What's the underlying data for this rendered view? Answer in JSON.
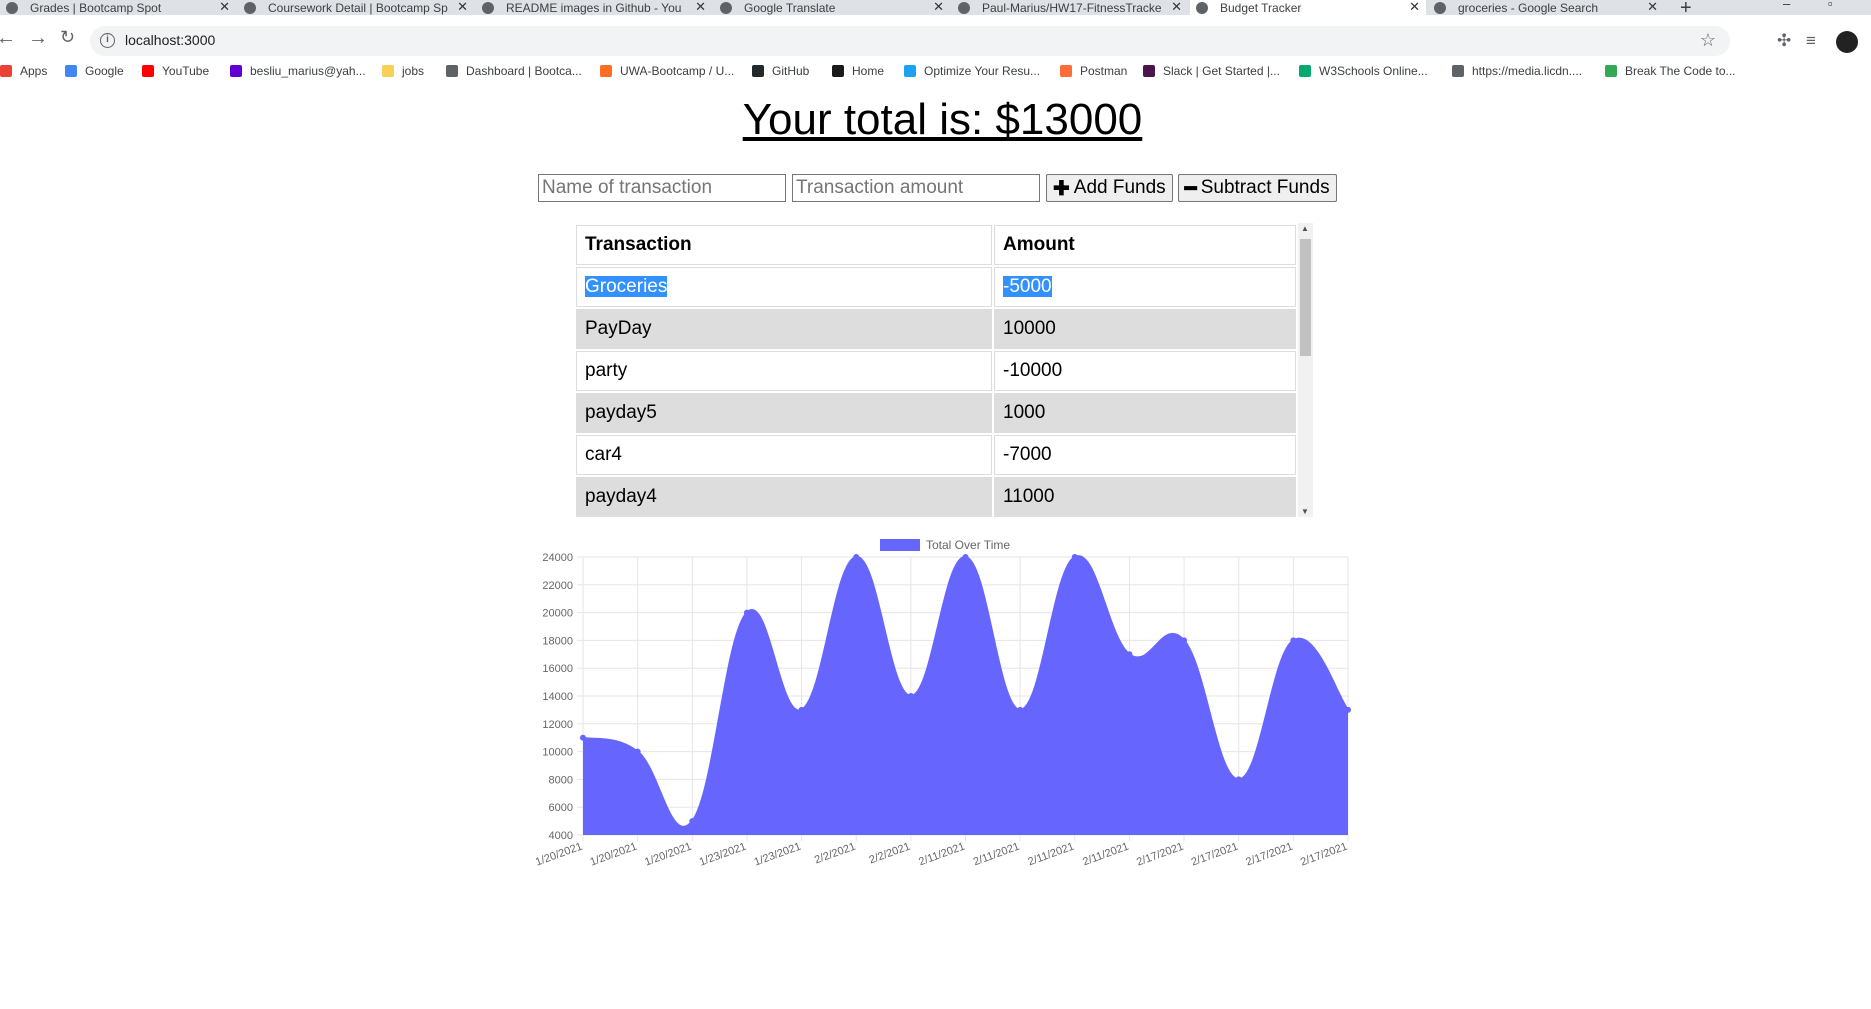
{
  "browser": {
    "tabs": [
      {
        "title": "Grades | Bootcamp Spot",
        "active": false
      },
      {
        "title": "Coursework Detail | Bootcamp Sp",
        "active": false
      },
      {
        "title": "README images in Github - You",
        "active": false
      },
      {
        "title": "Google Translate",
        "active": false
      },
      {
        "title": "Paul-Marius/HW17-FitnessTracke",
        "active": false
      },
      {
        "title": "Budget Tracker",
        "active": true
      },
      {
        "title": "groceries - Google Search",
        "active": false
      }
    ],
    "url": "localhost:3000",
    "bookmarks": [
      {
        "label": "Apps",
        "color": "#ea4335"
      },
      {
        "label": "Google",
        "color": "#4285f4"
      },
      {
        "label": "YouTube",
        "color": "#ff0000"
      },
      {
        "label": "besliu_marius@yah...",
        "color": "#6001d2"
      },
      {
        "label": "jobs",
        "color": "#f6d155"
      },
      {
        "label": "Dashboard | Bootca...",
        "color": "#5f6368"
      },
      {
        "label": "UWA-Bootcamp / U...",
        "color": "#fc6d26"
      },
      {
        "label": "GitHub",
        "color": "#24292e"
      },
      {
        "label": "Home",
        "color": "#1a1a1a"
      },
      {
        "label": "Optimize Your Resu...",
        "color": "#1da1f2"
      },
      {
        "label": "Postman",
        "color": "#ff6c37"
      },
      {
        "label": "Slack | Get Started |...",
        "color": "#4a154b"
      },
      {
        "label": "W3Schools Online...",
        "color": "#04aa6d"
      },
      {
        "label": "https://media.licdn....",
        "color": "#5f6368"
      },
      {
        "label": "Break The Code to...",
        "color": "#34a853"
      }
    ]
  },
  "page": {
    "title": "Your total is: $13000",
    "name_placeholder": "Name of transaction",
    "amount_placeholder": "Transaction amount",
    "add_label": "Add Funds",
    "subtract_label": "Subtract Funds",
    "table": {
      "headers": [
        "Transaction",
        "Amount"
      ],
      "rows": [
        {
          "name": "Groceries",
          "amount": "-5000",
          "selected": true
        },
        {
          "name": "PayDay",
          "amount": "10000"
        },
        {
          "name": "party",
          "amount": "-10000"
        },
        {
          "name": "payday5",
          "amount": "1000"
        },
        {
          "name": "car4",
          "amount": "-7000"
        },
        {
          "name": "payday4",
          "amount": "11000"
        }
      ]
    }
  },
  "chart_data": {
    "type": "area",
    "legend": "Total Over Time",
    "legend_position": "top",
    "color": "#6666ff",
    "categories": [
      "1/20/2021",
      "1/20/2021",
      "1/20/2021",
      "1/23/2021",
      "1/23/2021",
      "2/2/2021",
      "2/2/2021",
      "2/11/2021",
      "2/11/2021",
      "2/11/2021",
      "2/11/2021",
      "2/17/2021",
      "2/17/2021",
      "2/17/2021",
      "2/17/2021"
    ],
    "values": [
      11000,
      10000,
      5000,
      20000,
      13000,
      24000,
      14000,
      24000,
      13000,
      24000,
      17000,
      18000,
      8000,
      18000,
      13000
    ],
    "ylim": [
      4000,
      24000
    ],
    "yticks": [
      4000,
      6000,
      8000,
      10000,
      12000,
      14000,
      16000,
      18000,
      20000,
      22000,
      24000
    ],
    "grid": true
  }
}
